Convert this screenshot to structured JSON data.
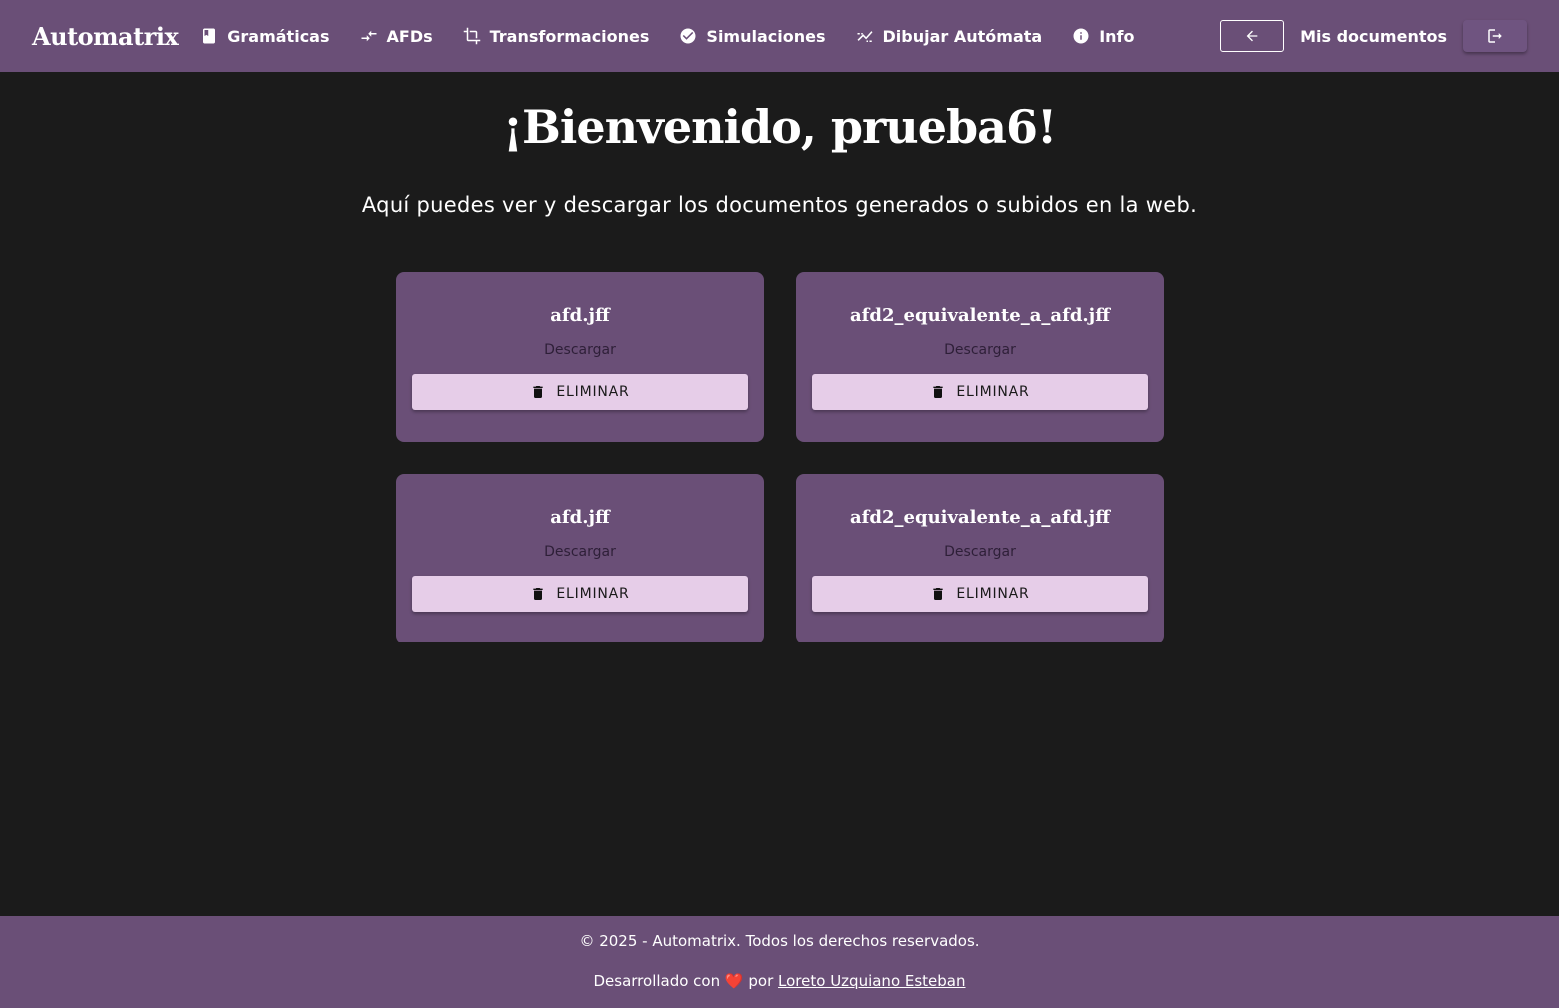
{
  "navbar": {
    "brand": "Automatrix",
    "items": [
      {
        "label": "Gramáticas",
        "icon": "book-icon"
      },
      {
        "label": "AFDs",
        "icon": "compare-arrows-icon"
      },
      {
        "label": "Transformaciones",
        "icon": "crop-icon"
      },
      {
        "label": "Simulaciones",
        "icon": "check-circle-icon"
      },
      {
        "label": "Dibujar Autómata",
        "icon": "draw-graph-icon"
      },
      {
        "label": "Info",
        "icon": "info-icon"
      }
    ],
    "back_icon": "arrow-left-icon",
    "my_documents": "Mis documentos",
    "logout_icon": "logout-icon"
  },
  "main": {
    "title": "¡Bienvenido, prueba6!",
    "subtitle": "Aquí puedes ver y descargar los documentos generados o subidos en la web.",
    "documents": [
      {
        "name": "afd.jff",
        "download": "Descargar",
        "delete": "ELIMINAR"
      },
      {
        "name": "afd2_equivalente_a_afd.jff",
        "download": "Descargar",
        "delete": "ELIMINAR"
      },
      {
        "name": "afd.jff",
        "download": "Descargar",
        "delete": "ELIMINAR"
      },
      {
        "name": "afd2_equivalente_a_afd.jff",
        "download": "Descargar",
        "delete": "ELIMINAR"
      }
    ]
  },
  "footer": {
    "copyright": "© 2025 - Automatrix. Todos los derechos reservados.",
    "dev_prefix": "Desarrollado con",
    "heart": "❤️",
    "dev_mid": "por",
    "author": "Loreto Uzquiano Esteban"
  },
  "colors": {
    "primary": "#6a4f77",
    "background": "#1b1b1b",
    "button_light": "#e6cde8"
  }
}
